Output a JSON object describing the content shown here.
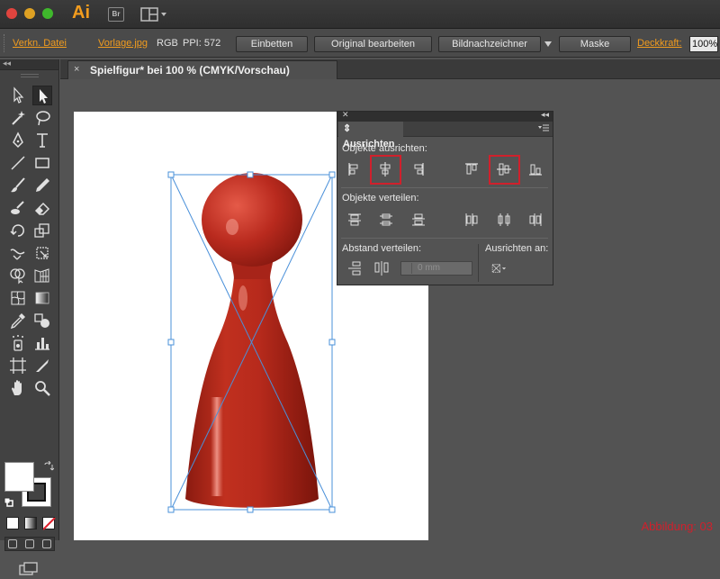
{
  "app": {
    "name": "Ai",
    "bridge_label": "Br"
  },
  "control_bar": {
    "embed_link": "Verkn. Datei",
    "file_link": "Vorlage.jpg",
    "color_mode": "RGB",
    "ppi": "PPI: 572",
    "embed_button": "Einbetten",
    "edit_original_button": "Original bearbeiten",
    "trace_button": "Bildnachzeichner",
    "mask_button": "Maske",
    "opacity_label": "Deckkraft:",
    "opacity_value": "100%"
  },
  "document": {
    "tab_title": "Spielfigur* bei 100 % (CMYK/Vorschau)",
    "tab_close": "×"
  },
  "tools": {
    "list": [
      "selection-tool",
      "direct-selection-tool",
      "magic-wand-tool",
      "lasso-tool",
      "pen-tool",
      "type-tool",
      "line-tool",
      "rectangle-tool",
      "paintbrush-tool",
      "pencil-tool",
      "blob-brush-tool",
      "eraser-tool",
      "rotate-tool",
      "scale-tool",
      "width-tool",
      "free-transform-tool",
      "shape-builder-tool",
      "perspective-grid-tool",
      "mesh-tool",
      "gradient-tool",
      "eyedropper-tool",
      "blend-tool",
      "symbol-sprayer-tool",
      "column-graph-tool",
      "artboard-tool",
      "slice-tool",
      "hand-tool",
      "zoom-tool"
    ],
    "fill_color": "#ffffff",
    "stroke_color": "#111111"
  },
  "align_panel": {
    "title": "Ausrichten",
    "align_objects_label": "Objekte ausrichten:",
    "distribute_objects_label": "Objekte verteilen:",
    "distribute_spacing_label": "Abstand verteilen:",
    "align_to_label": "Ausrichten an:",
    "spacing_value": "0 mm",
    "highlighted_buttons": [
      "horizontal-align-center-button",
      "vertical-align-center-button"
    ]
  },
  "artwork": {
    "object": "pawn",
    "fill_color": "#b82a1e",
    "highlight_color": "#d0202c",
    "selection_color": "#4a90d9"
  },
  "caption": "Abbildung: 03"
}
